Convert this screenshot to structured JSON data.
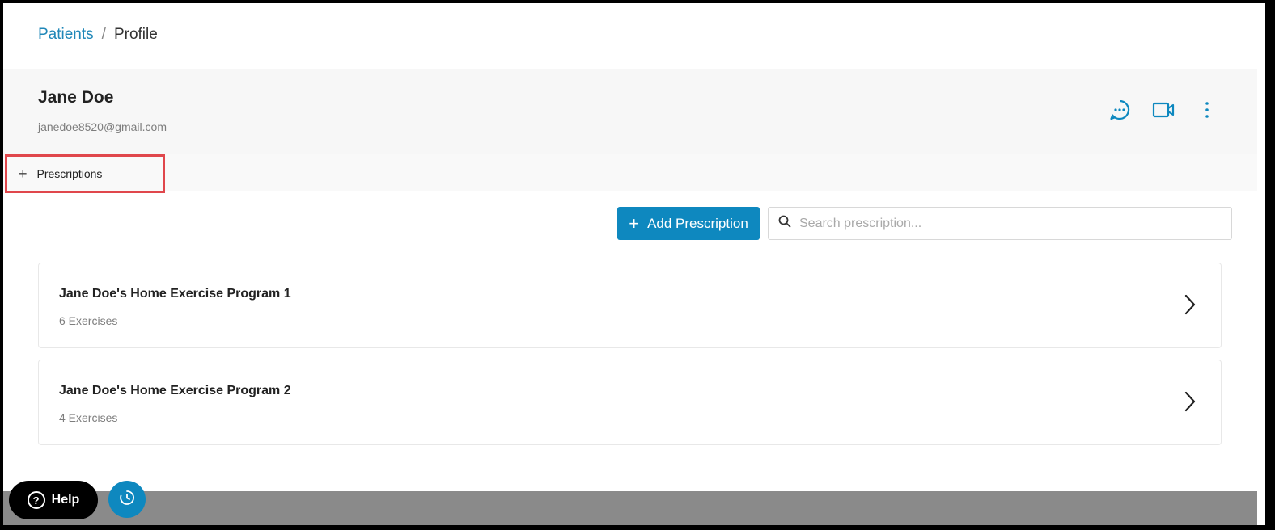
{
  "breadcrumb": {
    "link": "Patients",
    "separator": "/",
    "current": "Profile"
  },
  "patient": {
    "name": "Jane Doe",
    "email": "janedoe8520@gmail.com"
  },
  "header_icons": [
    "chat-icon",
    "video-camera-icon",
    "more-vertical-icon"
  ],
  "tabs": [
    {
      "label": "Prescriptions",
      "icon": "plus-icon"
    }
  ],
  "toolbar": {
    "add_label": "Add Prescription",
    "search_placeholder": "Search prescription..."
  },
  "prescriptions": [
    {
      "title": "Jane Doe's Home Exercise Program 1",
      "subtitle": "6 Exercises"
    },
    {
      "title": "Jane Doe's Home Exercise Program 2",
      "subtitle": "4 Exercises"
    }
  ],
  "help": {
    "label": "Help"
  },
  "colors": {
    "accent": "#0e88bf",
    "link": "#1f87b8",
    "highlight": "#e0474c"
  }
}
